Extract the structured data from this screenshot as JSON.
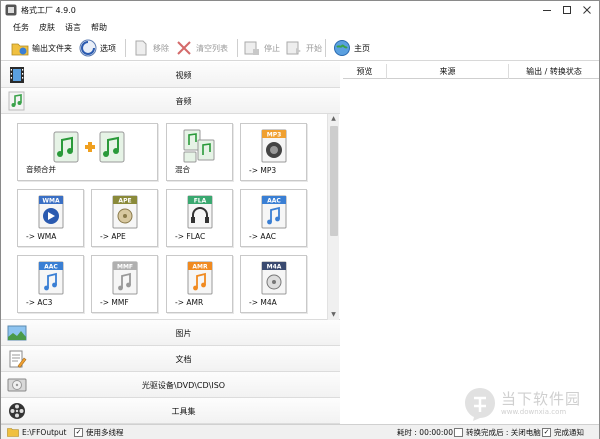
{
  "window": {
    "title": "格式工厂 4.9.0"
  },
  "menu": [
    "任务",
    "皮肤",
    "语言",
    "帮助"
  ],
  "toolbar": {
    "output_folder": "输出文件夹",
    "options": "选项",
    "remove": "移除",
    "clear_list": "清空列表",
    "stop": "停止",
    "start": "开始",
    "home": "主页"
  },
  "categories": {
    "video": "视频",
    "audio": "音频",
    "picture": "图片",
    "document": "文档",
    "disc": "光驱设备\\DVD\\CD\\ISO",
    "toolbox": "工具集"
  },
  "audio_tiles": [
    {
      "label": "音频合并",
      "badge": "",
      "badge_color": ""
    },
    {
      "label": "混合",
      "badge": "",
      "badge_color": ""
    },
    {
      "label": "-> MP3",
      "badge": "MP3",
      "badge_color": "#f0a030"
    },
    {
      "label": "-> WMA",
      "badge": "WMA",
      "badge_color": "#3a6fc4"
    },
    {
      "label": "-> APE",
      "badge": "APE",
      "badge_color": "#8a8a3a"
    },
    {
      "label": "-> FLAC",
      "badge": "FLA",
      "badge_color": "#3aa870"
    },
    {
      "label": "-> AAC",
      "badge": "AAC",
      "badge_color": "#3a7fd4"
    },
    {
      "label": "-> AC3",
      "badge": "AAC",
      "badge_color": "#3a7fd4"
    },
    {
      "label": "-> MMF",
      "badge": "MMF",
      "badge_color": "#b0b0b0"
    },
    {
      "label": "-> AMR",
      "badge": "AMR",
      "badge_color": "#f08a20"
    },
    {
      "label": "-> M4A",
      "badge": "M4A",
      "badge_color": "#3a4a70"
    }
  ],
  "table_headers": [
    "预览",
    "来源",
    "输出 / 转换状态"
  ],
  "watermark": {
    "text": "当下软件园",
    "url": "www.downxia.com"
  },
  "status": {
    "output_path": "E:\\FFOutput",
    "multithread": "使用多线程",
    "elapsed": "耗时 : 00:00:00",
    "after_convert": "转换完成后 : 关闭电脑",
    "notify": "完成通知"
  },
  "colors": {
    "accent_green": "#3aa24a",
    "accent_orange": "#f0a030",
    "window_border": "#8a8a8a"
  }
}
